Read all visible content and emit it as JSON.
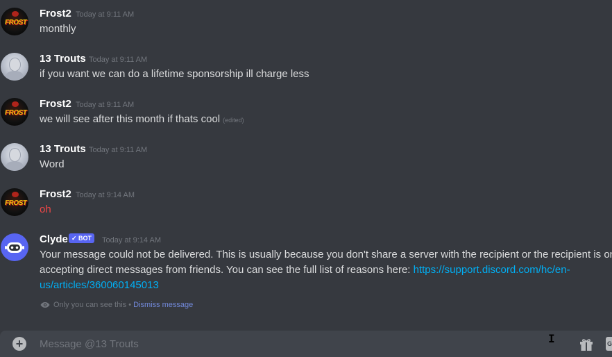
{
  "messages": [
    {
      "author": "Frost2",
      "time": "Today at 9:11 AM",
      "text": "monthly",
      "avatar": "frost2-avatar"
    },
    {
      "author": "13 Trouts",
      "time": "Today at 9:11 AM",
      "text": "if you want we can do a lifetime sponsorship ill charge less",
      "avatar": "trouts-avatar"
    },
    {
      "author": "Frost2",
      "time": "Today at 9:11 AM",
      "text": "we will see after this month if thats cool",
      "edited": "(edited)",
      "avatar": "frost2-avatar"
    },
    {
      "author": "13 Trouts",
      "time": "Today at 9:11 AM",
      "text": "Word",
      "avatar": "trouts-avatar"
    },
    {
      "author": "Frost2",
      "time": "Today at 9:14 AM",
      "text": "oh",
      "avatar": "frost2-avatar",
      "text_color": "#f04747"
    }
  ],
  "clyde": {
    "author": "Clyde",
    "badge": "✓ BOT",
    "time": "Today at 9:14 AM",
    "line1": "Your message could not be delivered. This is usually because you don't share a server with the recipient or the recipient is on",
    "line2_text": "accepting direct messages from friends. You can see the full list of reasons here: ",
    "line2_link": "https://support.discord.com/hc/en-",
    "line3_link": "us/articles/360060145013",
    "ephemeral_note": "Only you can see this •",
    "dismiss_label": "Dismiss message"
  },
  "composer": {
    "placeholder": "Message @13 Trouts",
    "gif_label": "G"
  },
  "colors": {
    "background": "#36393f",
    "composer_bg": "#40444b",
    "link": "#00aff4",
    "bot_badge": "#5865f2",
    "mention_red": "#f04747"
  },
  "icons": [
    "add-attachment-icon",
    "gift-icon",
    "gif-icon",
    "eye-icon",
    "bot-check-icon"
  ]
}
